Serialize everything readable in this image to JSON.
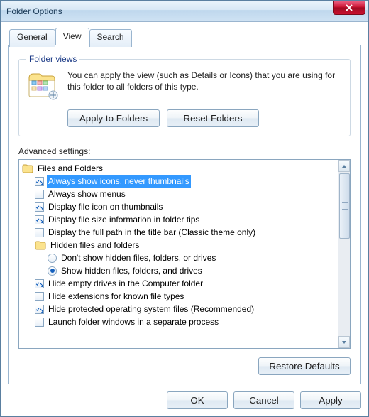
{
  "window": {
    "title": "Folder Options"
  },
  "tabs": {
    "general": "General",
    "view": "View",
    "search": "Search",
    "active": "view"
  },
  "folderViews": {
    "legend": "Folder views",
    "text": "You can apply the view (such as Details or Icons) that you are using for this folder to all folders of this type.",
    "applyButton": "Apply to Folders",
    "resetButton": "Reset Folders"
  },
  "advanced": {
    "label": "Advanced settings:",
    "root": "Files and Folders",
    "items": [
      {
        "type": "check",
        "checked": true,
        "selected": true,
        "label": "Always show icons, never thumbnails"
      },
      {
        "type": "check",
        "checked": false,
        "label": "Always show menus"
      },
      {
        "type": "check",
        "checked": true,
        "label": "Display file icon on thumbnails"
      },
      {
        "type": "check",
        "checked": true,
        "label": "Display file size information in folder tips"
      },
      {
        "type": "check",
        "checked": false,
        "label": "Display the full path in the title bar (Classic theme only)"
      },
      {
        "type": "folder",
        "label": "Hidden files and folders"
      },
      {
        "type": "radio",
        "checked": false,
        "indent": 2,
        "label": "Don't show hidden files, folders, or drives"
      },
      {
        "type": "radio",
        "checked": true,
        "indent": 2,
        "label": "Show hidden files, folders, and drives"
      },
      {
        "type": "check",
        "checked": true,
        "label": "Hide empty drives in the Computer folder"
      },
      {
        "type": "check",
        "checked": false,
        "label": "Hide extensions for known file types"
      },
      {
        "type": "check",
        "checked": true,
        "label": "Hide protected operating system files (Recommended)"
      },
      {
        "type": "check",
        "checked": false,
        "label": "Launch folder windows in a separate process"
      }
    ]
  },
  "buttons": {
    "restoreDefaults": "Restore Defaults",
    "ok": "OK",
    "cancel": "Cancel",
    "apply": "Apply"
  }
}
